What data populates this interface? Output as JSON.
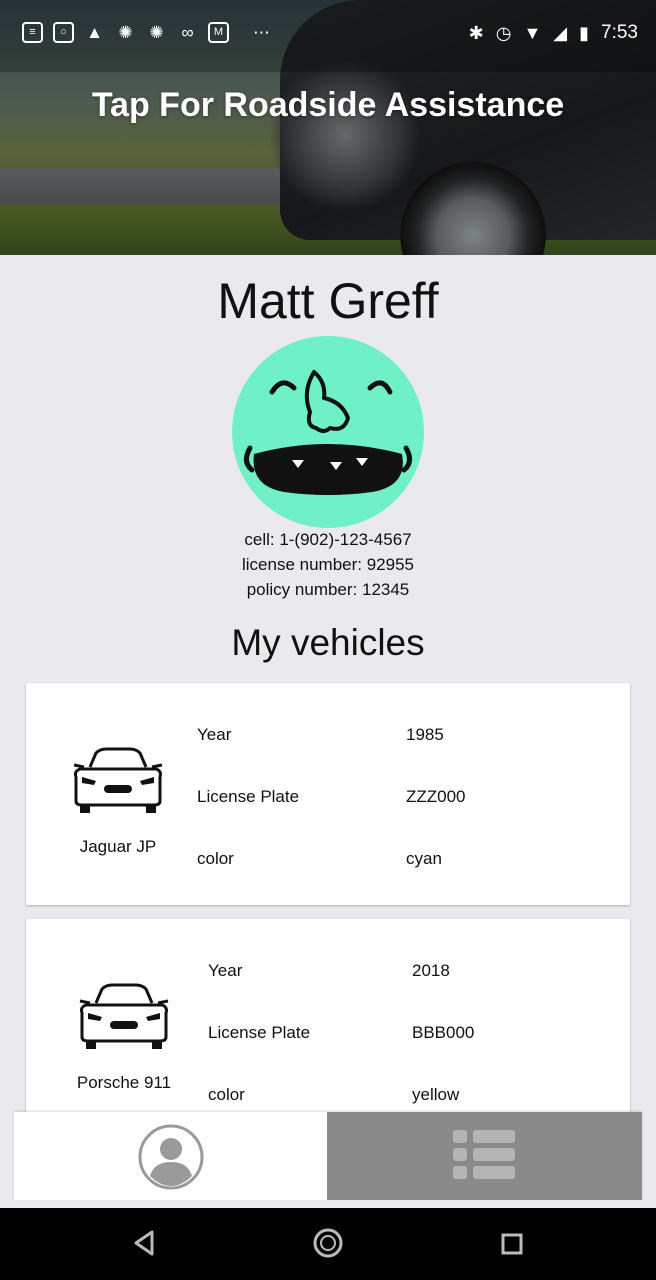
{
  "status_bar": {
    "time": "7:53",
    "left_icons": [
      "message-icon",
      "instagram-icon",
      "arrow-app-icon",
      "cbc-icon",
      "cbc-icon",
      "voicemail-icon",
      "gmail-icon",
      "more-icon"
    ],
    "right_icons": [
      "bluetooth-icon",
      "alarm-icon",
      "wifi-icon",
      "signal-icon",
      "battery-icon"
    ]
  },
  "banner": {
    "title": "Tap For Roadside Assistance"
  },
  "profile": {
    "name": "Matt Greff",
    "cell": "cell: 1-(902)-123-4567",
    "license": "license number: 92955",
    "policy": "policy number: 12345"
  },
  "vehicles_title": "My vehicles",
  "vehicles": [
    {
      "name": "Jaguar JP",
      "rows": [
        {
          "label": "Year",
          "value": "1985"
        },
        {
          "label": "License Plate",
          "value": "ZZZ000"
        },
        {
          "label": "color",
          "value": "cyan"
        }
      ]
    },
    {
      "name": "Porsche 911",
      "rows": [
        {
          "label": "Year",
          "value": "2018"
        },
        {
          "label": "License Plate",
          "value": "BBB000"
        },
        {
          "label": "color",
          "value": "yellow"
        }
      ]
    }
  ],
  "tabs": [
    {
      "icon": "profile-icon",
      "active": true
    },
    {
      "icon": "list-icon",
      "active": false
    }
  ],
  "colors": {
    "avatar": "#6ff0c6",
    "page_bg": "#e9e9ee",
    "inactive_tab": "#8a8a8a"
  }
}
